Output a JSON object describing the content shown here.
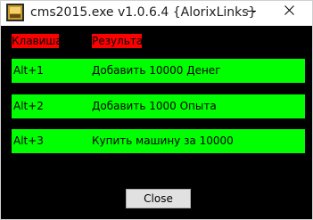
{
  "window": {
    "title": "cms2015.exe v1.0.6.4 {AlorixLinks}"
  },
  "table": {
    "headers": {
      "key": "Клавиша",
      "result": "Результат"
    },
    "header_color": "#ff0000",
    "row_color": "#00ff00",
    "rows": [
      {
        "key": "Alt+1",
        "result": "Добавить 10000 Денег"
      },
      {
        "key": "Alt+2",
        "result": "Добавить 1000 Опыта"
      },
      {
        "key": "Alt+3",
        "result": "Купить машину за 10000"
      }
    ]
  },
  "footer": {
    "close_label": "Close"
  },
  "icons": {
    "app": "app-icon",
    "minimize": "minimize-icon",
    "close": "close-icon"
  }
}
